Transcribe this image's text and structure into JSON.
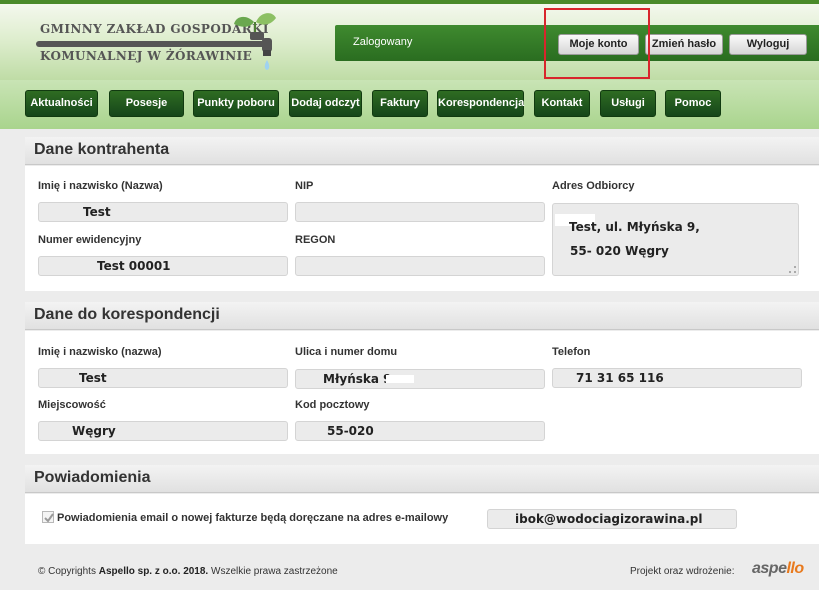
{
  "header": {
    "logo_line1": "GMINNY ZAKŁAD GOSPODARKI",
    "logo_line2": "KOMUNALNEJ W ŻÓRAWINIE",
    "status": "Zalogowany",
    "buttons": [
      "Moje konto",
      "Zmień hasło",
      "Wyloguj"
    ]
  },
  "nav": {
    "items": [
      "Aktualności",
      "Posesje",
      "Punkty poboru",
      "Dodaj odczyt",
      "Faktury",
      "Korespondencja",
      "Kontakt",
      "Usługi",
      "Pomoc"
    ]
  },
  "kontrahent": {
    "title": "Dane kontrahenta",
    "name_label": "Imię i nazwisko (Nazwa)",
    "name_value": "Test",
    "nip_label": "NIP",
    "nip_value": "",
    "address_label": "Adres Odbiorcy",
    "address_line1": "Test, ul. Młyńska 9,",
    "address_line2": "55- 020 Węgry",
    "number_label": "Numer ewidencyjny",
    "number_value": "Test 00001",
    "regon_label": "REGON",
    "regon_value": ""
  },
  "korespondencja": {
    "title": "Dane do korespondencji",
    "name_label": "Imię i nazwisko (nazwa)",
    "name_value": "Test",
    "street_label": "Ulica i numer domu",
    "street_value": "Młyńska 9",
    "phone_label": "Telefon",
    "phone_value": "71 31 65 116",
    "city_label": "Miejscowość",
    "city_value": "Węgry",
    "postal_label": "Kod pocztowy",
    "postal_value": "55-020"
  },
  "powiadomienia": {
    "title": "Powiadomienia",
    "checkbox_label": "Powiadomienia email o nowej fakturze będą doręczane na adres e-mailowy",
    "checked": true,
    "email": "ibok@wodociagizorawina.pl"
  },
  "footer": {
    "copyright_prefix": "© Copyrights",
    "company": "Aspello sp. z o.o. 2018.",
    "rights": "Wszelkie prawa zastrzeżone",
    "project_text": "Projekt oraz wdrożenie:",
    "brand_main": "aspe",
    "brand_accent": "llo"
  }
}
